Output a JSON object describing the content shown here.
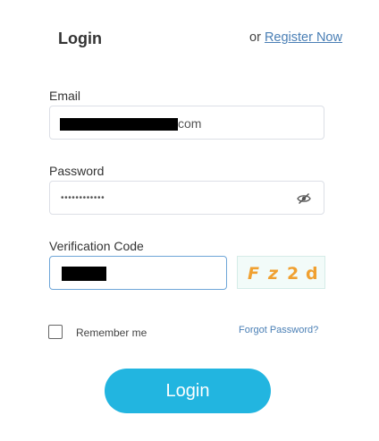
{
  "header": {
    "title": "Login",
    "register_prefix": "or",
    "register_link": "Register Now"
  },
  "email": {
    "label": "Email",
    "value_suffix": "com"
  },
  "password": {
    "label": "Password",
    "masked_value": "••••••••••••",
    "toggle_icon": "eye-slash-icon"
  },
  "verification": {
    "label": "Verification Code",
    "captcha_chars": [
      "F",
      "z",
      "2",
      "d"
    ]
  },
  "remember": {
    "label": "Remember me",
    "checked": false
  },
  "forgot": {
    "label": "Forgot Password?"
  },
  "login_button": {
    "label": "Login"
  },
  "colors": {
    "accent": "#22b5e0",
    "link": "#4a7fb5",
    "captcha_text": "#f0a030"
  }
}
